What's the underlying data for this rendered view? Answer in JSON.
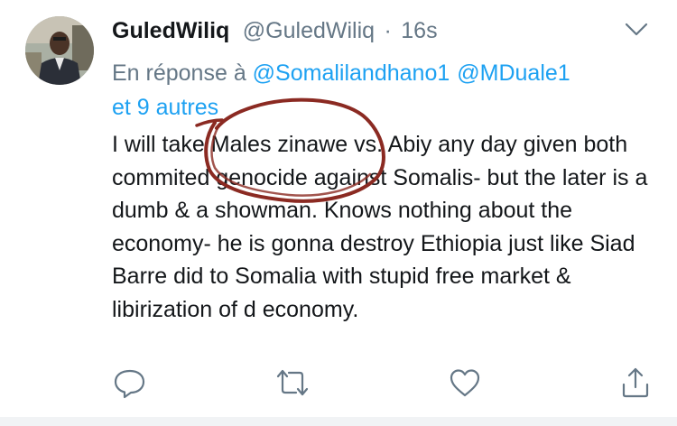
{
  "tweet": {
    "display_name": "GuledWiliq",
    "handle": "@GuledWiliq",
    "separator": "·",
    "time": "16s",
    "reply_prefix": "En réponse à",
    "mentions": [
      "@Somalilandhano1",
      "@MDuale1"
    ],
    "reply_suffix": "et 9 autres",
    "text": "I will take Males zinawe vs. Abiy any day given both commited genocide against Somalis- but the later is a dumb & a showman. Knows nothing about the economy- he is gonna destroy Ethiopia just like Siad Barre did to Somalia with stupid free market & libirization of d economy."
  },
  "icons": {
    "avatar": "profile-photo",
    "menu": "chevron-down-icon",
    "reply": "reply-icon",
    "retweet": "retweet-icon",
    "like": "heart-icon",
    "share": "share-icon"
  },
  "colors": {
    "name": "#14171a",
    "secondary": "#657786",
    "mention": "#1da1f2",
    "action_icon": "#657786",
    "annotation_circle": "#8b2a22"
  }
}
